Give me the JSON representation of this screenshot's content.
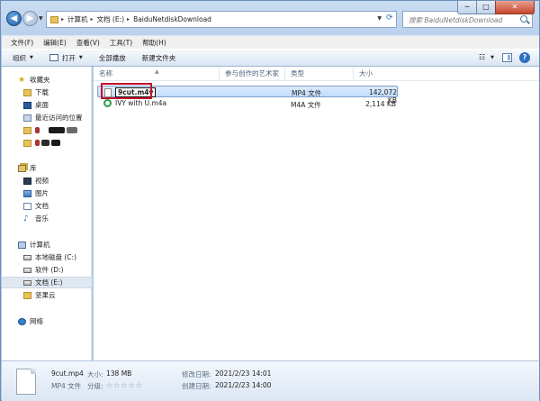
{
  "window": {
    "controls": {
      "min": "─",
      "max": "□",
      "close": "✕"
    }
  },
  "address": {
    "crumbs": [
      "计算机",
      "文档 (E:)",
      "BaiduNetdiskDownload"
    ],
    "separator": "▸"
  },
  "search": {
    "placeholder": "搜索 BaiduNetdiskDownload"
  },
  "menubar": [
    "文件(F)",
    "编辑(E)",
    "查看(V)",
    "工具(T)",
    "帮助(H)"
  ],
  "toolbar": {
    "organize": "组织",
    "open": "打开",
    "play_all": "全部播放",
    "new_folder": "新建文件夹",
    "view_icon": "☷",
    "help": "?"
  },
  "navpane": {
    "favorites": {
      "header": "收藏夹",
      "items": [
        "下载",
        "桌面",
        "最近访问的位置"
      ]
    },
    "libraries": {
      "header": "库",
      "items": [
        "视频",
        "图片",
        "文档",
        "音乐"
      ]
    },
    "computer": {
      "header": "计算机",
      "items": [
        "本地磁盘 (C:)",
        "软件 (D:)",
        "文档 (E:)",
        "坚果云"
      ]
    },
    "network": {
      "header": "网络"
    }
  },
  "columns": [
    "名称",
    "参与创作的艺术家",
    "类型",
    "大小"
  ],
  "files": [
    {
      "name": "9cut.m4v",
      "type": "MP4 文件",
      "size": "142,072 KB",
      "selected": true,
      "icon": "blank-file-icon"
    },
    {
      "name": "IVY with U.m4a",
      "type": "M4A 文件",
      "size": "2,114 KB",
      "selected": false,
      "icon": "music-file-icon"
    }
  ],
  "details": {
    "name": "9cut.mp4",
    "size_label": "大小:",
    "size": "138 MB",
    "type": "MP4 文件",
    "rating_label": "分级:",
    "rating": 0,
    "rating_max": 5,
    "modified_label": "修改日期:",
    "modified": "2021/2/23 14:01",
    "created_label": "创建日期:",
    "created": "2021/2/23 14:00"
  }
}
